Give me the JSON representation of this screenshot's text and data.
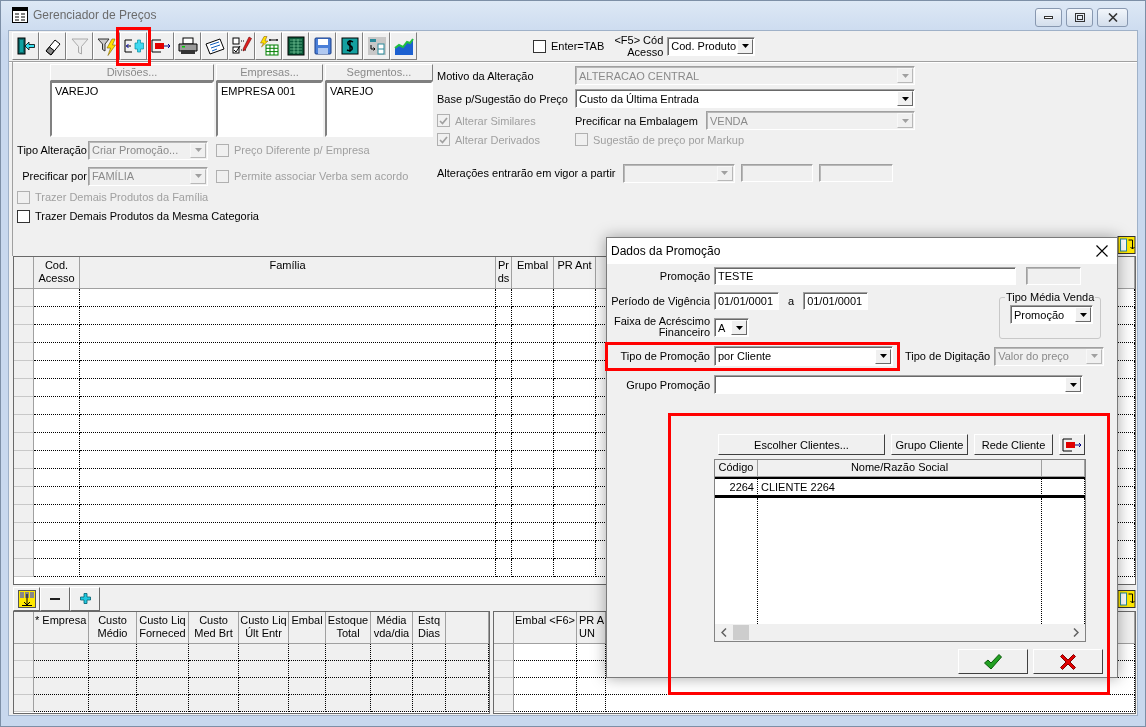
{
  "window": {
    "title": "Gerenciador de Preços"
  },
  "toolbar": {
    "buttons": [
      {
        "disabled": false,
        "highlighted": false
      },
      {
        "disabled": false,
        "highlighted": false
      },
      {
        "disabled": true,
        "highlighted": false
      },
      {
        "disabled": false,
        "highlighted": false
      },
      {
        "disabled": false,
        "highlighted": true
      },
      {
        "disabled": false,
        "highlighted": false
      },
      {
        "disabled": false,
        "highlighted": false
      },
      {
        "disabled": false,
        "highlighted": false
      },
      {
        "disabled": false,
        "highlighted": false
      },
      {
        "disabled": false,
        "highlighted": false
      },
      {
        "disabled": false,
        "highlighted": false
      },
      {
        "disabled": false,
        "highlighted": false
      },
      {
        "disabled": false,
        "highlighted": false
      },
      {
        "disabled": false,
        "highlighted": false
      },
      {
        "disabled": false,
        "highlighted": false
      }
    ],
    "enter_tab": {
      "label": "Enter=TAB",
      "checked": false
    },
    "access_code": {
      "label": "<F5> Cód Acesso",
      "value": "Cod. Produto"
    }
  },
  "selection_lists": [
    {
      "header": "Divisões...",
      "disabled": true,
      "items": [
        "VAREJO"
      ]
    },
    {
      "header": "Empresas...",
      "disabled": true,
      "items": [
        "EMPRESA 001"
      ]
    },
    {
      "header": "Segmentos...",
      "disabled": true,
      "items": [
        "VAREJO"
      ]
    }
  ],
  "change_options": {
    "tipo_alteracao": {
      "label": "Tipo Alteração",
      "value": "Criar Promoção...",
      "disabled": true
    },
    "preco_diferente": {
      "label": "Preço Diferente p/ Empresa",
      "checked": false,
      "disabled": true
    },
    "precificar_por": {
      "label": "Precificar por",
      "value": "FAMÍLIA",
      "disabled": true
    },
    "permite_verba": {
      "label": "Permite associar Verba sem acordo",
      "checked": false,
      "disabled": true
    },
    "trazer_familia": {
      "label": "Trazer Demais Produtos da Família",
      "checked": false,
      "disabled": true
    },
    "trazer_categoria": {
      "label": "Trazer Demais Produtos da Mesma Categoria",
      "checked": false,
      "disabled": false
    }
  },
  "pricing": {
    "motivo": {
      "label": "Motivo da Alteração",
      "value": "ALTERACAO CENTRAL",
      "disabled": true
    },
    "base": {
      "label": "Base p/Sugestão do Preço",
      "value": "Custo da Última Entrada",
      "disabled": false
    },
    "alterar_similares": {
      "label": "Alterar Similares",
      "checked": true,
      "disabled": true
    },
    "alterar_derivados": {
      "label": "Alterar Derivados",
      "checked": true,
      "disabled": true
    },
    "embalagem": {
      "label": "Precificar na Embalagem",
      "value": "VENDA",
      "disabled": true
    },
    "markup": {
      "label": "Sugestão de preço por Markup",
      "checked": false,
      "disabled": true
    },
    "vigor": {
      "label": "Alterações entrarão em vigor a partir",
      "disabled": true
    }
  },
  "product_grid": {
    "columns": [
      "Cod. Acesso",
      "Família",
      "Pr ds",
      "Embal",
      "PR Ant"
    ]
  },
  "cost_grid": {
    "disabled": true,
    "columns": [
      "* Empresa",
      "Custo Médio",
      "Custo Liq Forneced",
      "Custo Med Brt",
      "Custo Liq Últ Entr",
      "Embal",
      "Estoque Total",
      "Média vda/dia",
      "Estq Dias"
    ]
  },
  "package_grid": {
    "disabled": false,
    "columns": [
      "Embal <F6>",
      "PR A UN"
    ]
  },
  "dialog": {
    "title": "Dados da Promoção",
    "promocao": {
      "label": "Promoção",
      "value": "TESTE"
    },
    "periodo": {
      "label": "Período de Vigência",
      "from": "01/01/0001",
      "separator": "a",
      "to": "01/01/0001"
    },
    "faixa": {
      "label": "Faixa de Acréscimo Financeiro",
      "value": "A"
    },
    "tipo_media_venda": {
      "label": "Tipo Média Venda",
      "value": "Promoção"
    },
    "tipo_promocao": {
      "label": "Tipo de Promoção",
      "value": "por Cliente",
      "highlighted": true
    },
    "tipo_digitacao": {
      "label": "Tipo de Digitação",
      "value": "Valor do preço",
      "disabled": true
    },
    "grupo_promocao": {
      "label": "Grupo Promoção"
    },
    "clients": {
      "highlighted": true,
      "buttons": [
        "Escolher Clientes...",
        "Grupo Cliente",
        "Rede Cliente"
      ],
      "columns": [
        "Código",
        "Nome/Razão Social"
      ],
      "rows": [
        {
          "code": "2264",
          "name": "CLIENTE 2264",
          "selected": true
        }
      ]
    }
  }
}
